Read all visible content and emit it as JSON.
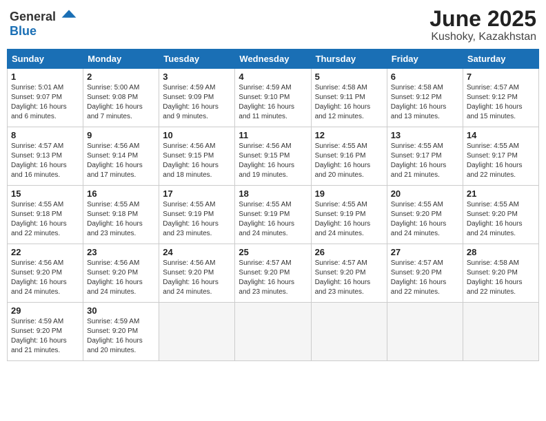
{
  "header": {
    "logo": {
      "general": "General",
      "blue": "Blue"
    },
    "month": "June 2025",
    "location": "Kushoky, Kazakhstan"
  },
  "weekdays": [
    "Sunday",
    "Monday",
    "Tuesday",
    "Wednesday",
    "Thursday",
    "Friday",
    "Saturday"
  ],
  "weeks": [
    [
      {
        "day": 1,
        "sunrise": "5:01 AM",
        "sunset": "9:07 PM",
        "daylight": "16 hours and 6 minutes."
      },
      {
        "day": 2,
        "sunrise": "5:00 AM",
        "sunset": "9:08 PM",
        "daylight": "16 hours and 7 minutes."
      },
      {
        "day": 3,
        "sunrise": "4:59 AM",
        "sunset": "9:09 PM",
        "daylight": "16 hours and 9 minutes."
      },
      {
        "day": 4,
        "sunrise": "4:59 AM",
        "sunset": "9:10 PM",
        "daylight": "16 hours and 11 minutes."
      },
      {
        "day": 5,
        "sunrise": "4:58 AM",
        "sunset": "9:11 PM",
        "daylight": "16 hours and 12 minutes."
      },
      {
        "day": 6,
        "sunrise": "4:58 AM",
        "sunset": "9:12 PM",
        "daylight": "16 hours and 13 minutes."
      },
      {
        "day": 7,
        "sunrise": "4:57 AM",
        "sunset": "9:12 PM",
        "daylight": "16 hours and 15 minutes."
      }
    ],
    [
      {
        "day": 8,
        "sunrise": "4:57 AM",
        "sunset": "9:13 PM",
        "daylight": "16 hours and 16 minutes."
      },
      {
        "day": 9,
        "sunrise": "4:56 AM",
        "sunset": "9:14 PM",
        "daylight": "16 hours and 17 minutes."
      },
      {
        "day": 10,
        "sunrise": "4:56 AM",
        "sunset": "9:15 PM",
        "daylight": "16 hours and 18 minutes."
      },
      {
        "day": 11,
        "sunrise": "4:56 AM",
        "sunset": "9:15 PM",
        "daylight": "16 hours and 19 minutes."
      },
      {
        "day": 12,
        "sunrise": "4:55 AM",
        "sunset": "9:16 PM",
        "daylight": "16 hours and 20 minutes."
      },
      {
        "day": 13,
        "sunrise": "4:55 AM",
        "sunset": "9:17 PM",
        "daylight": "16 hours and 21 minutes."
      },
      {
        "day": 14,
        "sunrise": "4:55 AM",
        "sunset": "9:17 PM",
        "daylight": "16 hours and 22 minutes."
      }
    ],
    [
      {
        "day": 15,
        "sunrise": "4:55 AM",
        "sunset": "9:18 PM",
        "daylight": "16 hours and 22 minutes."
      },
      {
        "day": 16,
        "sunrise": "4:55 AM",
        "sunset": "9:18 PM",
        "daylight": "16 hours and 23 minutes."
      },
      {
        "day": 17,
        "sunrise": "4:55 AM",
        "sunset": "9:19 PM",
        "daylight": "16 hours and 23 minutes."
      },
      {
        "day": 18,
        "sunrise": "4:55 AM",
        "sunset": "9:19 PM",
        "daylight": "16 hours and 24 minutes."
      },
      {
        "day": 19,
        "sunrise": "4:55 AM",
        "sunset": "9:19 PM",
        "daylight": "16 hours and 24 minutes."
      },
      {
        "day": 20,
        "sunrise": "4:55 AM",
        "sunset": "9:20 PM",
        "daylight": "16 hours and 24 minutes."
      },
      {
        "day": 21,
        "sunrise": "4:55 AM",
        "sunset": "9:20 PM",
        "daylight": "16 hours and 24 minutes."
      }
    ],
    [
      {
        "day": 22,
        "sunrise": "4:56 AM",
        "sunset": "9:20 PM",
        "daylight": "16 hours and 24 minutes."
      },
      {
        "day": 23,
        "sunrise": "4:56 AM",
        "sunset": "9:20 PM",
        "daylight": "16 hours and 24 minutes."
      },
      {
        "day": 24,
        "sunrise": "4:56 AM",
        "sunset": "9:20 PM",
        "daylight": "16 hours and 24 minutes."
      },
      {
        "day": 25,
        "sunrise": "4:57 AM",
        "sunset": "9:20 PM",
        "daylight": "16 hours and 23 minutes."
      },
      {
        "day": 26,
        "sunrise": "4:57 AM",
        "sunset": "9:20 PM",
        "daylight": "16 hours and 23 minutes."
      },
      {
        "day": 27,
        "sunrise": "4:57 AM",
        "sunset": "9:20 PM",
        "daylight": "16 hours and 22 minutes."
      },
      {
        "day": 28,
        "sunrise": "4:58 AM",
        "sunset": "9:20 PM",
        "daylight": "16 hours and 22 minutes."
      }
    ],
    [
      {
        "day": 29,
        "sunrise": "4:59 AM",
        "sunset": "9:20 PM",
        "daylight": "16 hours and 21 minutes."
      },
      {
        "day": 30,
        "sunrise": "4:59 AM",
        "sunset": "9:20 PM",
        "daylight": "16 hours and 20 minutes."
      },
      null,
      null,
      null,
      null,
      null
    ]
  ]
}
